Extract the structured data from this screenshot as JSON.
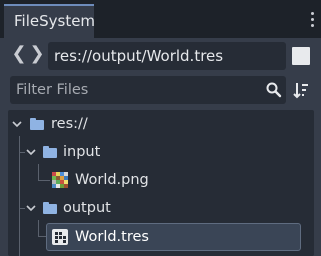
{
  "dock": {
    "tab_label": "FileSystem"
  },
  "navigation": {
    "back_glyph": "❮",
    "forward_glyph": "❯",
    "path": "res://output/World.tres"
  },
  "filter": {
    "placeholder": "Filter Files"
  },
  "tree": {
    "root": {
      "label": "res://",
      "icon": "folder-icon",
      "expanded": true
    },
    "folders": [
      {
        "label": "input",
        "icon": "folder-icon",
        "expanded": true,
        "files": [
          {
            "label": "World.png",
            "icon": "image-file-icon"
          }
        ]
      },
      {
        "label": "output",
        "icon": "folder-icon",
        "expanded": true,
        "files": [
          {
            "label": "World.tres",
            "icon": "tileset-resource-icon",
            "selected": true
          }
        ]
      }
    ]
  },
  "colors": {
    "background": "#1d2229",
    "panel": "#363d4a",
    "field": "#262c36",
    "folder_accent": "#8fb3e3",
    "tab_highlight": "#6e8cbb",
    "selection": "#3a4556"
  }
}
